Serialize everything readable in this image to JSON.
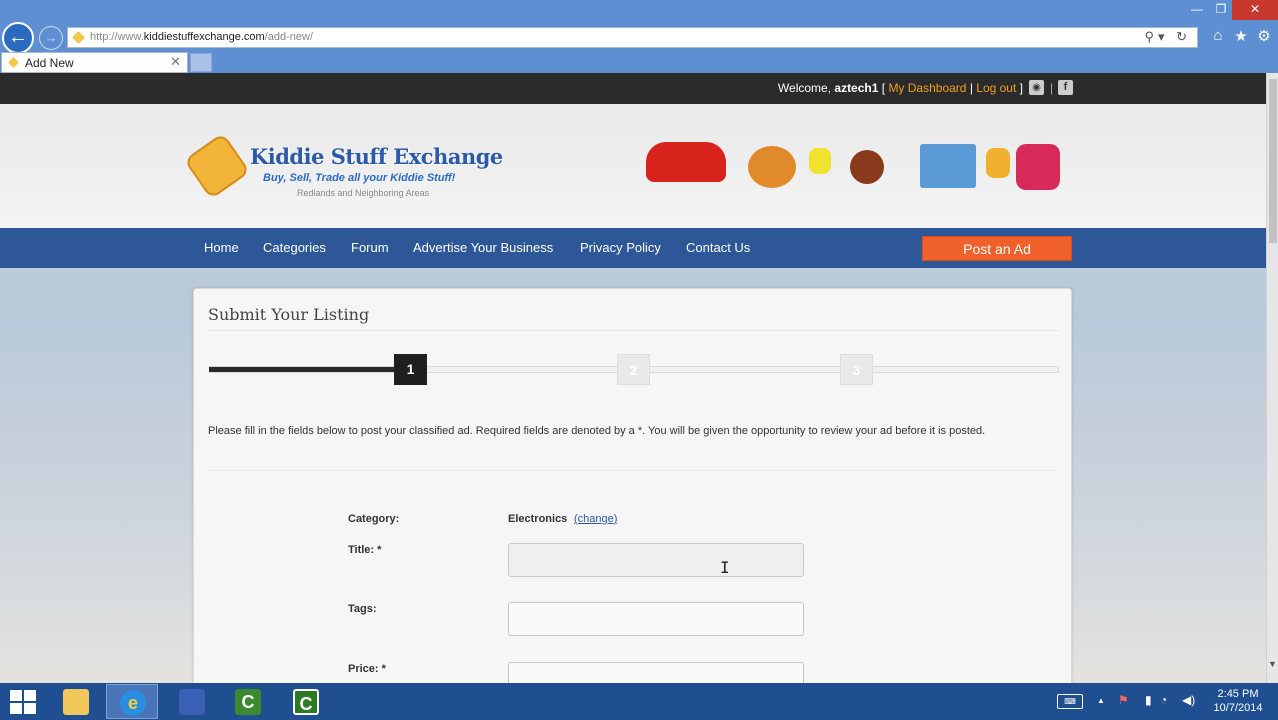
{
  "browser": {
    "url_prefix": "http://www.",
    "url_domain": "kiddiestuffexchange.com",
    "url_path": "/add-new/",
    "tab_title": "Add New",
    "tab_close": "✕",
    "addr_icons": "⚲▾ ↻",
    "win_min": "—",
    "win_restore": "❐",
    "win_close": "✕",
    "back_glyph": "←",
    "fwd_glyph": "→",
    "home_icon": "⌂",
    "fav_icon": "★",
    "settings_icon": "⚙"
  },
  "site": {
    "welcome_prefix": "Welcome, ",
    "username": "aztech1",
    "bracket_open": " [ ",
    "dashboard_link": "My Dashboard",
    "pipe": " | ",
    "logout_link": "Log out",
    "bracket_close": " ] ",
    "rss_icon": "◉",
    "fb_icon": "f",
    "sep": "|",
    "logo_title": "Kiddie Stuff Exchange",
    "logo_tagline": "Buy, Sell, Trade all your Kiddie Stuff!",
    "logo_subtitle": "Redlands and Neighboring Areas"
  },
  "nav": {
    "items": [
      "Home",
      "Categories",
      "Forum",
      "Advertise Your Business",
      "Privacy Policy",
      "Contact Us"
    ],
    "post_ad": "Post an Ad"
  },
  "form": {
    "title": "Submit Your Listing",
    "progress_fraction": 0.22,
    "steps": [
      "1",
      "2",
      "3"
    ],
    "current_step": 1,
    "intro": "Please fill in the fields below to post your classified ad. Required fields are denoted by a *. You will be given the opportunity to review your ad before it is posted.",
    "category_label": "Category:",
    "category_value": "Electronics",
    "change_link": "(change)",
    "title_label": "Title: *",
    "title_value": "",
    "tags_label": "Tags:",
    "tags_value": "",
    "price_label": "Price: *",
    "price_value": "",
    "cursor": "I"
  },
  "taskbar": {
    "apps": [
      "file-explorer",
      "internet-explorer",
      "network-app",
      "camtasia",
      "camtasia-recorder"
    ],
    "ie_glyph": "e",
    "camtasia_glyph": "C",
    "keyboard_icon": "⌨",
    "tray_up": "▲",
    "flag_icon": "⚑",
    "battery_icon": "▮",
    "network_icon": "◔",
    "display_icon": "▭",
    "volume_icon": "◀)",
    "time": "2:45 PM",
    "date": "10/7/2014"
  }
}
